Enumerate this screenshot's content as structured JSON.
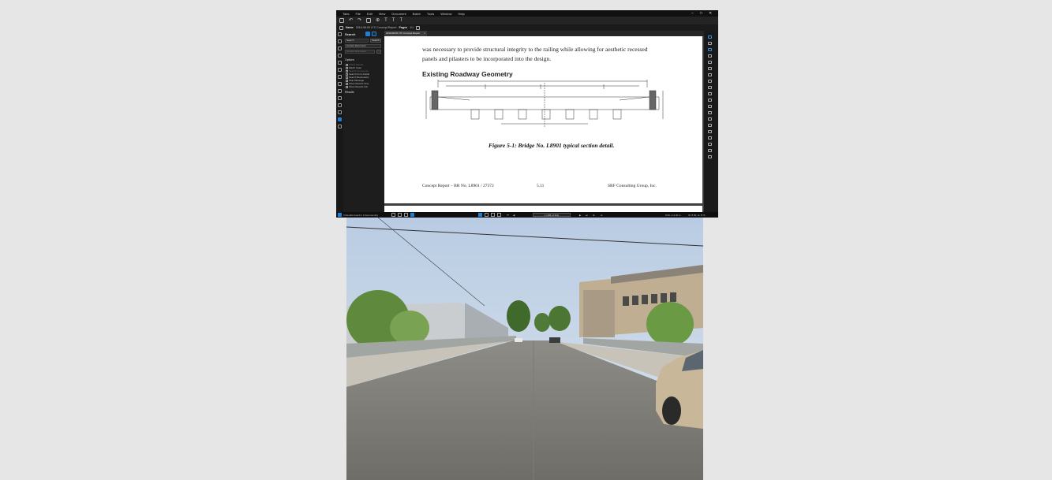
{
  "menu": [
    "Tabs",
    "File",
    "Edit",
    "View",
    "Document",
    "Batch",
    "Tools",
    "Window",
    "Help"
  ],
  "window_controls": [
    "−",
    "□",
    "✕"
  ],
  "toolbar": {
    "document_label": "Name",
    "document_name": "2016.08.05 LTC Concept Report",
    "pages_label": "Pages",
    "pages_value": "1/1"
  },
  "search_panel": {
    "title": "Search",
    "search_placeholder": "Search",
    "search_button": "Search",
    "scope": "Current Document",
    "field_placeholder": "Current Document",
    "options_heading": "Options",
    "options": [
      {
        "label": "Whole Words",
        "enabled": false
      },
      {
        "label": "Match Case",
        "enabled": true
      },
      {
        "label": "Search Comments",
        "enabled": false
      },
      {
        "label": "Search Form Fields",
        "enabled": true
      },
      {
        "label": "Search Bookmarks",
        "enabled": true
      },
      {
        "label": "Stop Message",
        "enabled": true
      },
      {
        "label": "Show Results Only",
        "enabled": true
      },
      {
        "label": "Show Results Info",
        "enabled": true
      }
    ],
    "results_heading": "Results"
  },
  "tab": {
    "label": "2016.08.05 LTC Concept Report"
  },
  "document": {
    "line1": "was necessary to provide structural integrity to the railing while allowing for aesthetic recessed",
    "line2": "panels and pilasters to be incorporated into the design.",
    "heading": "Existing Roadway Geometry",
    "figure_caption": "Figure 5-1: Bridge No. L8901 typical section detail.",
    "footer_left": "Concept Report – BR No. L8901 / 27372",
    "footer_center": "5.11",
    "footer_right": "SRF Consulting Group, Inc."
  },
  "statusbar": {
    "left_text": "0 Results found in 0 document(s)",
    "page_field": "1 (196 of 311)",
    "dimensions": "8.50 x 11.00 in",
    "zoom_text": "W: 8.50, H: 8.71"
  }
}
